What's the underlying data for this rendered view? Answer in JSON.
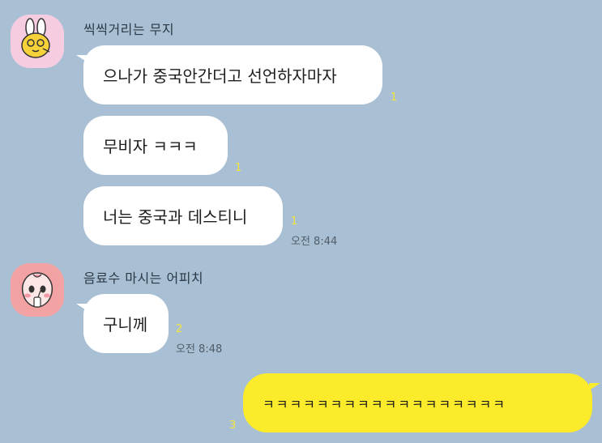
{
  "colors": {
    "background": "#a9bfd3",
    "my_bubble": "#fbeb2a",
    "their_bubble": "#ffffff",
    "unread": "#f5e43a"
  },
  "groups": [
    {
      "sender": "씩씩거리는 무지",
      "avatar_icon": "muzi-character-icon",
      "messages": [
        {
          "text": "으나가 중국안간더고 선언하자마자",
          "unread": "1"
        },
        {
          "text": "무비자 ㅋㅋㅋ",
          "unread": "1"
        },
        {
          "text": "너는 중국과 데스티니",
          "unread": "1",
          "time": "오전 8:44"
        }
      ]
    },
    {
      "sender": "음료수 마시는 어피치",
      "avatar_icon": "apeach-character-icon",
      "messages": [
        {
          "text": "구니께",
          "unread": "2",
          "time": "오전 8:48"
        }
      ]
    }
  ],
  "my_messages": [
    {
      "text": "ㅋㅋㅋㅋㅋㅋㅋㅋㅋㅋㅋㅋㅋㅋㅋㅋㅋㅋ",
      "unread": "3"
    }
  ]
}
